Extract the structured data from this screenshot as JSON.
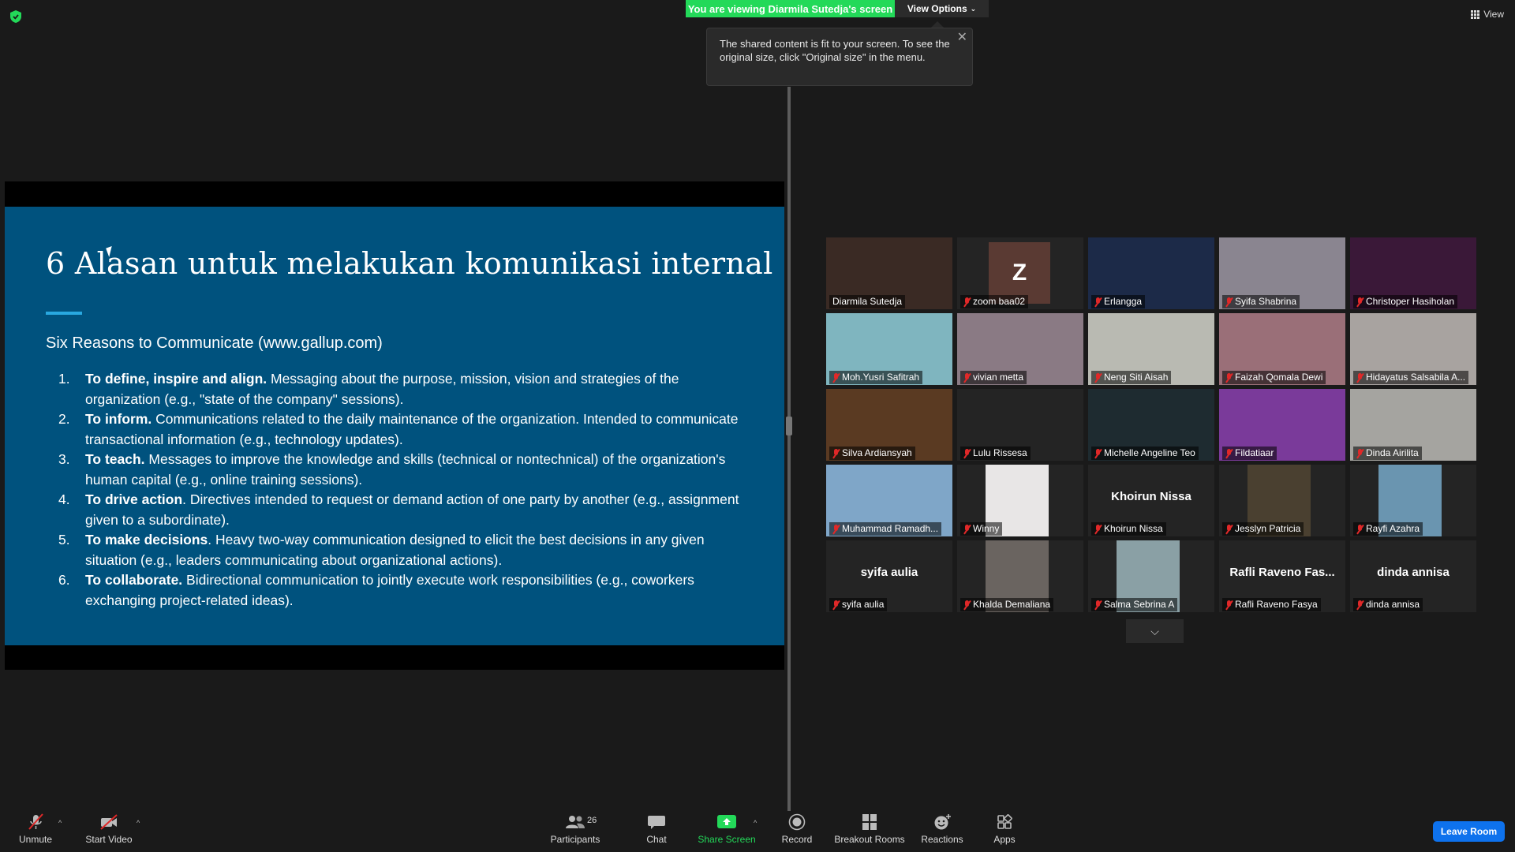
{
  "colors": {
    "accent_green": "#23d959",
    "slide_bg": "#00527e",
    "active_speaker": "#d8e65a",
    "leave_blue": "#0e72ed",
    "mute_red": "#e02828"
  },
  "top": {
    "viewing_banner": "You are viewing Diarmila Sutedja's screen",
    "view_options": "View Options",
    "tooltip": "The shared content is fit to your screen. To see the original size, click \"Original size\" in the menu.",
    "view_label": "View"
  },
  "slide": {
    "title": "6 Alasan untuk melakukan komunikasi internal",
    "subtitle": "Six Reasons to Communicate (www.gallup.com)",
    "items": [
      {
        "num": "1.",
        "bold": "To define, inspire and align.",
        "text": " Messaging about the purpose, mission, vision and strategies of the organization (e.g., \"state of the company\" sessions)."
      },
      {
        "num": "2.",
        "bold": "To inform.",
        "text": " Communications related to the daily maintenance of the organization. Intended to communicate transactional information (e.g., technology updates)."
      },
      {
        "num": "3.",
        "bold": "To teach.",
        "text": " Messages to improve the knowledge and skills (technical or nontechnical) of the organization's human capital (e.g., online training sessions)."
      },
      {
        "num": "4.",
        "bold": "To drive action",
        "text": ". Directives intended to request or demand action of one party by another (e.g., assignment given to a subordinate)."
      },
      {
        "num": "5.",
        "bold": "To make decisions",
        "text": ". Heavy two-way communication designed to elicit the best decisions in any given situation (e.g., leaders communicating about organizational actions)."
      },
      {
        "num": "6.",
        "bold": "To collaborate.",
        "text": " Bidirectional communication to jointly execute work responsibilities (e.g., coworkers exchanging project-related ideas)."
      }
    ]
  },
  "participants": [
    {
      "name": "Diarmila Sutedja",
      "muted": false,
      "active": true,
      "bg": "#3a2a24"
    },
    {
      "name": "zoom baa02",
      "muted": true,
      "avatar": "Z"
    },
    {
      "name": "Erlangga",
      "muted": true,
      "bg": "#1c2a48"
    },
    {
      "name": "Syifa Shabrina",
      "muted": true,
      "bg": "#8a8590"
    },
    {
      "name": "Christoper Hasiholan",
      "muted": true,
      "bg": "#3a1838"
    },
    {
      "name": "Moh.Yusri Safitrah",
      "muted": true,
      "bg": "#7fb5bf"
    },
    {
      "name": "vivian metta",
      "muted": true,
      "bg": "#8a7a84"
    },
    {
      "name": "Neng Siti Aisah",
      "muted": true,
      "bg": "#b9bab2"
    },
    {
      "name": "Faizah Qomala Dewi",
      "muted": true,
      "bg": "#9a6f78"
    },
    {
      "name": "Hidayatus Salsabila A...",
      "muted": true,
      "bg": "#a8a3a0"
    },
    {
      "name": "Silva Ardiansyah",
      "muted": true,
      "bg": "#5a3a22"
    },
    {
      "name": "Lulu Rissesa",
      "muted": true,
      "bg": "#242424"
    },
    {
      "name": "Michelle Angeline Teo",
      "muted": true,
      "bg": "#1e2b30"
    },
    {
      "name": "Fildatiaar",
      "muted": true,
      "bg": "#7a3a9a"
    },
    {
      "name": "Dinda Airilita",
      "muted": true,
      "bg": "#a5a4a0"
    },
    {
      "name": "Muhammad Ramadh...",
      "muted": true,
      "bg": "#7fa6c8"
    },
    {
      "name": "Winny",
      "muted": true,
      "bg": "#e8e6e6",
      "inset": true
    },
    {
      "name": "Khoirun Nissa",
      "muted": true,
      "big": "Khoirun Nissa"
    },
    {
      "name": "Jesslyn Patricia",
      "muted": true,
      "bg": "#4a4030",
      "inset": true
    },
    {
      "name": "Rayfi Azahra",
      "muted": true,
      "bg": "#6a95b0",
      "inset": true
    },
    {
      "name": "syifa aulia",
      "muted": true,
      "big": "syifa aulia"
    },
    {
      "name": "Khalda Demaliana",
      "muted": true,
      "bg": "#6a6460",
      "inset": true
    },
    {
      "name": "Salma Sebrina A",
      "muted": true,
      "bg": "#8aa0a5",
      "inset": true
    },
    {
      "name": "Rafli Raveno Fasya",
      "muted": true,
      "big": "Rafli Raveno Fas..."
    },
    {
      "name": "dinda annisa",
      "muted": true,
      "big": "dinda annisa"
    }
  ],
  "toolbar": {
    "unmute": "Unmute",
    "start_video": "Start Video",
    "participants": "Participants",
    "participants_count": "26",
    "chat": "Chat",
    "share_screen": "Share Screen",
    "record": "Record",
    "breakout_rooms": "Breakout Rooms",
    "reactions": "Reactions",
    "apps": "Apps",
    "leave": "Leave Room"
  }
}
